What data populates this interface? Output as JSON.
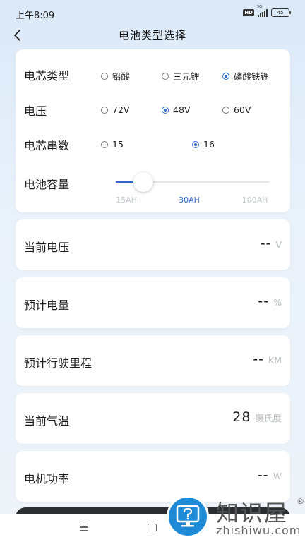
{
  "status_bar": {
    "time": "上午8:09",
    "hd": "HD",
    "network": "5G",
    "battery": "45"
  },
  "header": {
    "title": "电池类型选择"
  },
  "config": {
    "cell_type": {
      "label": "电芯类型",
      "options": [
        "铅酸",
        "三元锂",
        "磷酸铁锂"
      ],
      "selected": "磷酸铁锂"
    },
    "voltage": {
      "label": "电压",
      "options": [
        "72V",
        "48V",
        "60V"
      ],
      "selected": "48V"
    },
    "cell_series": {
      "label": "电芯串数",
      "options": [
        "15",
        "16"
      ],
      "selected": "16"
    },
    "capacity": {
      "label": "电池容量",
      "ticks": [
        "15AH",
        "30AH",
        "100AH"
      ],
      "selected": "30AH",
      "slider_fraction": 0.18
    }
  },
  "info": [
    {
      "label": "当前电压",
      "value": "--",
      "unit": "V"
    },
    {
      "label": "预计电量",
      "value": "--",
      "unit": "%"
    },
    {
      "label": "预计行驶里程",
      "value": "--",
      "unit": "KM"
    },
    {
      "label": "当前气温",
      "value": "28",
      "unit": "摄氏度"
    },
    {
      "label": "电机功率",
      "value": "--",
      "unit": "W"
    }
  ],
  "watermark": {
    "brand": "知识屋",
    "reg": "®",
    "url": "zhishiwu.com"
  },
  "colors": {
    "accent": "#2f69c9",
    "watermark_blue": "#1f8ad6"
  }
}
